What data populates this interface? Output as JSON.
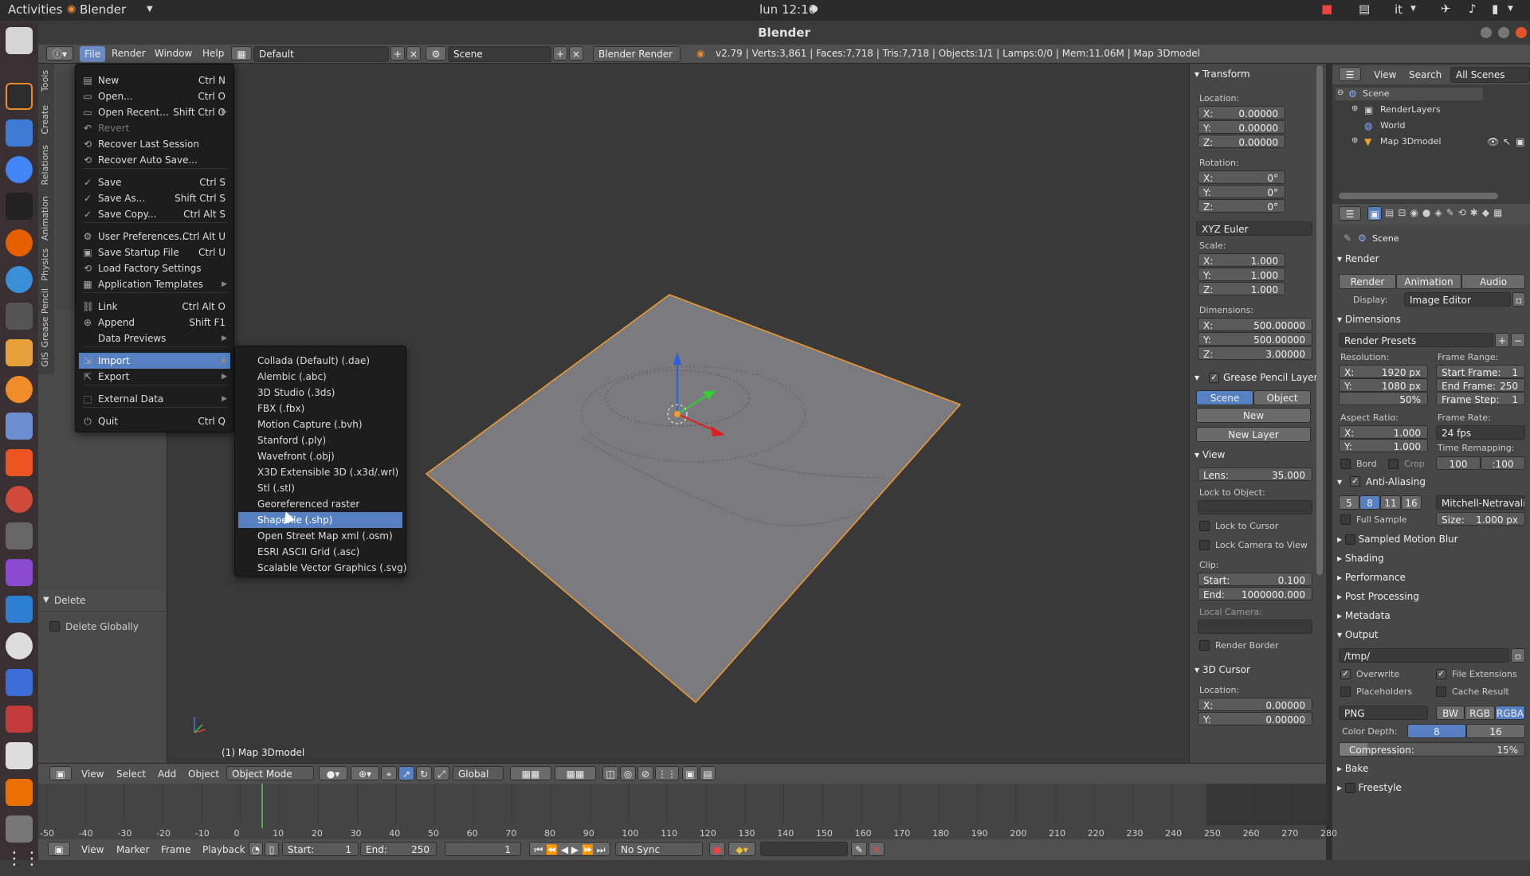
{
  "topbar": {
    "activities": "Activities",
    "app": "Blender",
    "clock": "lun 12:16",
    "lang": "it"
  },
  "window": {
    "title": "Blender"
  },
  "info_header": {
    "menus": [
      "File",
      "Render",
      "Window",
      "Help"
    ],
    "layout": "Default",
    "scene": "Scene",
    "engine": "Blender Render",
    "stats": "v2.79 | Verts:3,861 | Faces:7,718 | Tris:7,718 | Objects:1/1 | Lamps:0/0 | Mem:11.06M | Map 3Dmodel"
  },
  "file_menu": {
    "items": [
      {
        "label": "New",
        "shortcut": "Ctrl N",
        "icon": "document-icon"
      },
      {
        "label": "Open...",
        "shortcut": "Ctrl O",
        "icon": "folder-icon"
      },
      {
        "label": "Open Recent...",
        "shortcut": "Shift Ctrl O",
        "icon": "folder-icon"
      },
      {
        "label": "Revert",
        "shortcut": "",
        "icon": "revert-icon"
      },
      {
        "label": "Recover Last Session",
        "shortcut": "",
        "icon": "recover-icon"
      },
      {
        "label": "Recover Auto Save...",
        "shortcut": "",
        "icon": "recover-icon"
      },
      {
        "label": "Save",
        "shortcut": "Ctrl S",
        "icon": "check-icon"
      },
      {
        "label": "Save As...",
        "shortcut": "Shift Ctrl S",
        "icon": "check-icon"
      },
      {
        "label": "Save Copy...",
        "shortcut": "Ctrl Alt S",
        "icon": "check-icon"
      },
      {
        "label": "User Preferences...",
        "shortcut": "Ctrl Alt U",
        "icon": "preferences-icon"
      },
      {
        "label": "Save Startup File",
        "shortcut": "Ctrl U",
        "icon": "save-icon"
      },
      {
        "label": "Load Factory Settings",
        "shortcut": "",
        "icon": "load-icon"
      },
      {
        "label": "Application Templates",
        "shortcut": "",
        "icon": "templates-icon"
      },
      {
        "label": "Link",
        "shortcut": "Ctrl Alt O",
        "icon": "link-icon"
      },
      {
        "label": "Append",
        "shortcut": "Shift F1",
        "icon": "append-icon"
      },
      {
        "label": "Data Previews",
        "shortcut": "",
        "icon": ""
      },
      {
        "label": "Import",
        "shortcut": "",
        "icon": "import-icon"
      },
      {
        "label": "Export",
        "shortcut": "",
        "icon": "export-icon"
      },
      {
        "label": "External Data",
        "shortcut": "",
        "icon": "external-icon"
      },
      {
        "label": "Quit",
        "shortcut": "Ctrl Q",
        "icon": "power-icon"
      }
    ]
  },
  "import_menu": {
    "items": [
      "Collada (Default) (.dae)",
      "Alembic (.abc)",
      "3D Studio (.3ds)",
      "FBX (.fbx)",
      "Motion Capture (.bvh)",
      "Stanford (.ply)",
      "Wavefront (.obj)",
      "X3D Extensible 3D (.x3d/.wrl)",
      "Stl (.stl)",
      "Georeferenced raster",
      "Shapefile (.shp)",
      "Open Street Map xml (.osm)",
      "ESRI ASCII Grid (.asc)",
      "Scalable Vector Graphics (.svg)"
    ],
    "highlighted": "Shapefile (.shp)"
  },
  "toolshelf": {
    "tabs": [
      "Tools",
      "Create",
      "Relations",
      "Animation",
      "Physics",
      "Grease Pencil",
      "GIS"
    ],
    "operator_panel": "Delete",
    "delete_globally": "Delete Globally"
  },
  "viewport": {
    "object_label": "(1) Map 3Dmodel"
  },
  "npanel": {
    "transform": "Transform",
    "location": "Location:",
    "loc": [
      "X:",
      "0.00000",
      "Y:",
      "0.00000",
      "Z:",
      "0.00000"
    ],
    "rotation": "Rotation:",
    "rot": [
      "X:",
      "0°",
      "Y:",
      "0°",
      "Z:",
      "0°"
    ],
    "rot_mode": "XYZ Euler",
    "scale": "Scale:",
    "scl": [
      "X:",
      "1.000",
      "Y:",
      "1.000",
      "Z:",
      "1.000"
    ],
    "dimensions": "Dimensions:",
    "dim": [
      "X:",
      "500.00000",
      "Y:",
      "500.00000",
      "Z:",
      "3.00000"
    ],
    "gp_layers": "Grease Pencil Layers",
    "scene_btn": "Scene",
    "object_btn": "Object",
    "new_btn": "New",
    "new_layer": "New Layer",
    "view": "View",
    "lens": "Lens:",
    "lens_val": "35.000",
    "lock_to_object": "Lock to Object:",
    "lock_to_cursor": "Lock to Cursor",
    "lock_cam": "Lock Camera to View",
    "clip": "Clip:",
    "clip_start": "Start:",
    "clip_start_val": "0.100",
    "clip_end": "End:",
    "clip_end_val": "1000000.000",
    "local_camera": "Local Camera:",
    "render_border": "Render Border",
    "cursor": "3D Cursor",
    "cursor_loc": "Location:",
    "cur": [
      "X:",
      "0.00000",
      "Y:",
      "0.00000"
    ]
  },
  "outliner": {
    "menus": [
      "View",
      "Search"
    ],
    "filter": "All Scenes",
    "items": [
      "Scene",
      "RenderLayers",
      "World",
      "Map 3Dmodel"
    ]
  },
  "properties": {
    "context": "Scene",
    "render": "Render",
    "render_btns": [
      "Render",
      "Animation",
      "Audio"
    ],
    "display": "Display:",
    "display_val": "Image Editor",
    "dimensions": "Dimensions",
    "render_presets": "Render Presets",
    "resolution": "Resolution:",
    "res": [
      "X:",
      "1920 px",
      "Y:",
      "1080 px",
      "50%"
    ],
    "frame_range": "Frame Range:",
    "frames": [
      "Start Frame:",
      "1",
      "End Frame:",
      "250",
      "Frame Step:",
      "1"
    ],
    "aspect": "Aspect Ratio:",
    "asp": [
      "X:",
      "1.000",
      "Y:",
      "1.000"
    ],
    "frame_rate": "Frame Rate:",
    "fps": "24 fps",
    "time_remap": "Time Remapping:",
    "remap": [
      "100",
      ":100"
    ],
    "bord": "Bord",
    "crop": "Crop",
    "aa": "Anti-Aliasing",
    "aa_samples": [
      "5",
      "8",
      "11",
      "16"
    ],
    "aa_filter": "Mitchell-Netravali",
    "full_sample": "Full Sample",
    "aa_size": "Size:",
    "aa_size_val": "1.000 px",
    "sections": [
      "Sampled Motion Blur",
      "Shading",
      "Performance",
      "Post Processing",
      "Metadata"
    ],
    "output": "Output",
    "out_path": "/tmp/",
    "overwrite": "Overwrite",
    "file_ext": "File Extensions",
    "placeholders": "Placeholders",
    "cache_result": "Cache Result",
    "format": "PNG",
    "color_modes": [
      "BW",
      "RGB",
      "RGBA"
    ],
    "color_depth": "Color Depth:",
    "depths": [
      "8",
      "16"
    ],
    "compression": "Compression:",
    "compression_val": "15%",
    "bake": "Bake",
    "freestyle": "Freestyle"
  },
  "vp_header": {
    "menus": [
      "View",
      "Select",
      "Add",
      "Object"
    ],
    "mode": "Object Mode",
    "orientation": "Global"
  },
  "timeline": {
    "ticks": [
      "-50",
      "-40",
      "-30",
      "-20",
      "-10",
      "0",
      "10",
      "20",
      "30",
      "40",
      "50",
      "60",
      "70",
      "80",
      "90",
      "100",
      "110",
      "120",
      "130",
      "140",
      "150",
      "160",
      "170",
      "180",
      "190",
      "200",
      "210",
      "220",
      "230",
      "240",
      "250",
      "260",
      "270",
      "280"
    ],
    "menus": [
      "View",
      "Marker",
      "Frame",
      "Playback"
    ],
    "start": "Start:",
    "start_val": "1",
    "end": "End:",
    "end_val": "250",
    "current": "1",
    "sync": "No Sync"
  }
}
